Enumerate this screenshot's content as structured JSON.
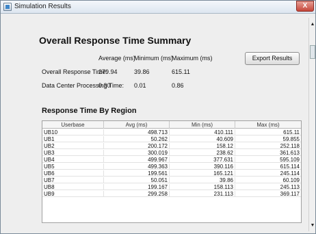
{
  "window": {
    "title": "Simulation Results",
    "close_glyph": "X"
  },
  "summary": {
    "heading": "Overall Response Time Summary",
    "columns": [
      "Average (ms)",
      "Minimum (ms)",
      "Maximum (ms)"
    ],
    "rows": [
      {
        "label": "Overall Response Time:",
        "avg": "279.94",
        "min": "39.86",
        "max": "615.11"
      },
      {
        "label": "Data Center Processing Time:",
        "avg": "0.30",
        "min": "0.01",
        "max": "0.86"
      }
    ],
    "export_label": "Export Results"
  },
  "region": {
    "heading": "Response Time By Region",
    "columns": [
      "Userbase",
      "Avg (ms)",
      "Min (ms)",
      "Max (ms)"
    ],
    "rows": [
      [
        "UB10",
        "498.713",
        "410.111",
        "615.11"
      ],
      [
        "UB1",
        "50.262",
        "40.609",
        "59.855"
      ],
      [
        "UB2",
        "200.172",
        "158.12",
        "252.118"
      ],
      [
        "UB3",
        "300.019",
        "238.62",
        "361.613"
      ],
      [
        "UB4",
        "499.967",
        "377.631",
        "595.109"
      ],
      [
        "UB5",
        "499.363",
        "390.116",
        "615.114"
      ],
      [
        "UB6",
        "199.561",
        "165.121",
        "245.114"
      ],
      [
        "UB7",
        "50.051",
        "39.86",
        "60.109"
      ],
      [
        "UB8",
        "199.167",
        "158.113",
        "245.113"
      ],
      [
        "UB9",
        "299.258",
        "231.113",
        "369.117"
      ]
    ]
  }
}
